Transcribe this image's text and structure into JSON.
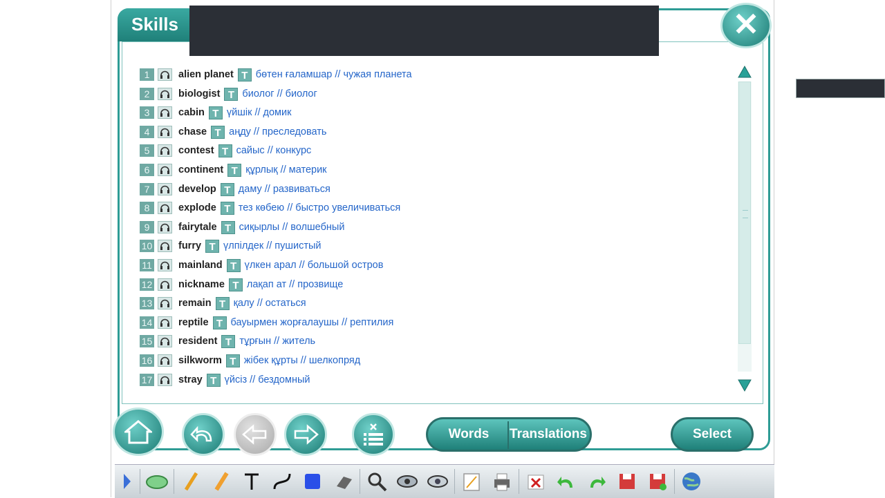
{
  "header": {
    "title": "Skills",
    "close_label": "✕"
  },
  "words": [
    {
      "num": "1",
      "word": "alien planet",
      "t": "T",
      "translation": "бөтен ғаламшар // чужая планета"
    },
    {
      "num": "2",
      "word": "biologist",
      "t": "T",
      "translation": "биолог // биолог"
    },
    {
      "num": "3",
      "word": "cabin",
      "t": "T",
      "translation": "үйшік // домик"
    },
    {
      "num": "4",
      "word": "chase",
      "t": "T",
      "translation": "аңду // преследовать"
    },
    {
      "num": "5",
      "word": "contest",
      "t": "T",
      "translation": "сайыс // конкурс"
    },
    {
      "num": "6",
      "word": "continent",
      "t": "T",
      "translation": "құрлық // материк"
    },
    {
      "num": "7",
      "word": "develop",
      "t": "T",
      "translation": "даму // развиваться"
    },
    {
      "num": "8",
      "word": "explode",
      "t": "T",
      "translation": "тез көбею // быстро увеличиваться"
    },
    {
      "num": "9",
      "word": "fairytale",
      "t": "T",
      "translation": "сиқырлы // волшебный"
    },
    {
      "num": "10",
      "word": "furry",
      "t": "T",
      "translation": "үлпілдек // пушистый"
    },
    {
      "num": "11",
      "word": "mainland",
      "t": "T",
      "translation": "үлкен арал // большой остров"
    },
    {
      "num": "12",
      "word": "nickname",
      "t": "T",
      "translation": "лақап ат // прозвище"
    },
    {
      "num": "13",
      "word": "remain",
      "t": "T",
      "translation": "қалу // остаться"
    },
    {
      "num": "14",
      "word": "reptile",
      "t": "T",
      "translation": "бауырмен жорғалаушы // рептилия"
    },
    {
      "num": "15",
      "word": "resident",
      "t": "T",
      "translation": "тұрғын // житель"
    },
    {
      "num": "16",
      "word": "silkworm",
      "t": "T",
      "translation": "жібек құрты // шелкопряд"
    },
    {
      "num": "17",
      "word": "stray",
      "t": "T",
      "translation": "үйсіз // бездомный"
    }
  ],
  "buttons": {
    "words": "Words",
    "translations": "Translations",
    "select": "Select"
  },
  "colors": {
    "accent": "#2e9c95",
    "link": "#2566c9",
    "title_bar": "#2b2f36"
  },
  "toolbar_icons": [
    "play-icon",
    "mouse-icon",
    "pencil-icon",
    "highlighter-icon",
    "text-icon",
    "freehand-icon",
    "rectangle-icon",
    "eraser-icon",
    "magnifier-icon",
    "spotlight-icon",
    "reveal-icon",
    "notepad-icon",
    "print-icon",
    "clear-icon",
    "undo-icon",
    "redo-icon",
    "save-icon",
    "save-as-icon",
    "globe-icon"
  ]
}
